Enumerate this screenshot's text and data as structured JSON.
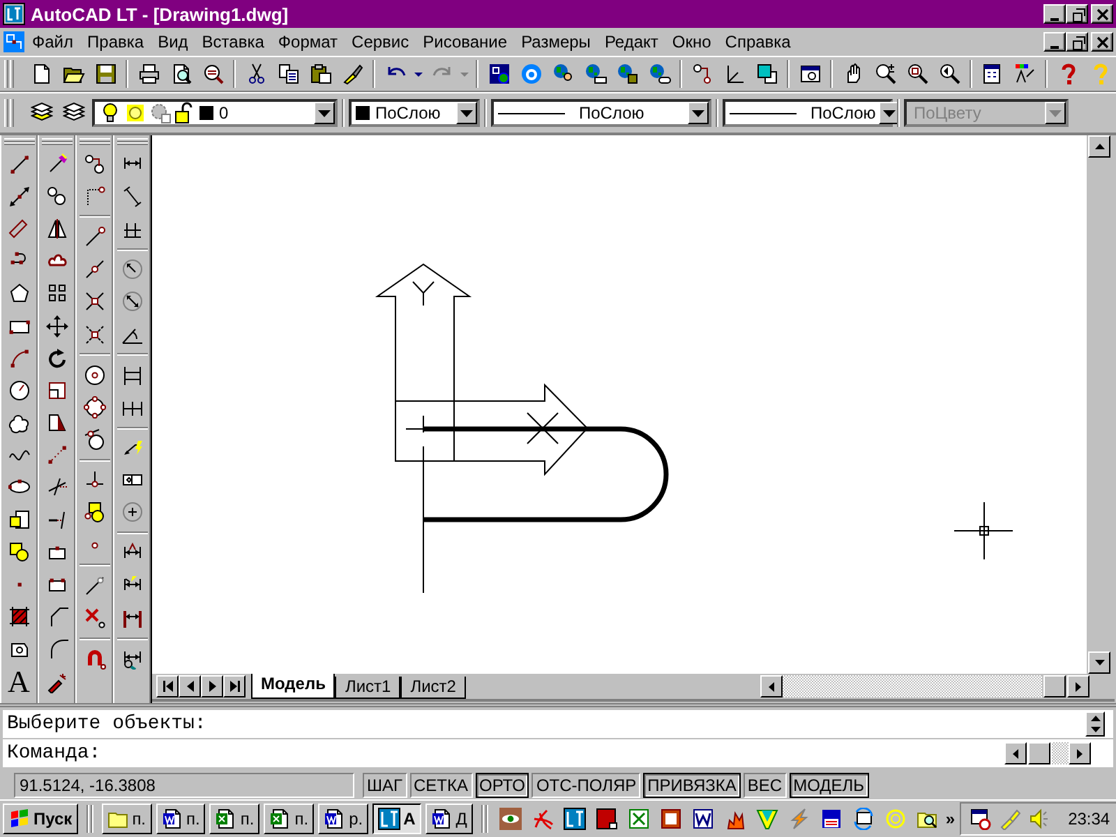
{
  "window": {
    "title": "AutoCAD LT - [Drawing1.dwg]"
  },
  "menu": [
    "Файл",
    "Правка",
    "Вид",
    "Вставка",
    "Формат",
    "Сервис",
    "Рисование",
    "Размеры",
    "Редакт",
    "Окно",
    "Справка"
  ],
  "layer_bar": {
    "layer": "0",
    "color_control": "ПоСлою",
    "linetype": "ПоСлою",
    "lineweight": "ПоСлою",
    "plot_style": {
      "value": "ПоЦвету",
      "disabled": true
    }
  },
  "text_tool": "A",
  "layout_tabs": [
    {
      "label": "Модель",
      "selected": true
    },
    {
      "label": "Лист1",
      "selected": false
    },
    {
      "label": "Лист2",
      "selected": false
    }
  ],
  "command_lines": [
    "Выберите объекты:",
    "Команда:"
  ],
  "status_bar": {
    "coordinates": "91.5124, -16.3808",
    "toggles": [
      {
        "label": "ШАГ",
        "on": false
      },
      {
        "label": "СЕТКА",
        "on": false
      },
      {
        "label": "ОРТО",
        "on": true
      },
      {
        "label": "ОТС-ПОЛЯР",
        "on": false
      },
      {
        "label": "ПРИВЯЗКА",
        "on": true
      },
      {
        "label": "ВЕС",
        "on": false
      },
      {
        "label": "МОДЕЛЬ",
        "on": true
      }
    ]
  },
  "taskbar": {
    "start": "Пуск",
    "buttons": [
      {
        "kind": "folder",
        "label": "п.",
        "selected": false
      },
      {
        "kind": "word",
        "label": "п.",
        "selected": false
      },
      {
        "kind": "excel",
        "label": "п.",
        "selected": false
      },
      {
        "kind": "excel",
        "label": "п.",
        "selected": false
      },
      {
        "kind": "word",
        "label": "р.",
        "selected": false
      },
      {
        "kind": "autocad",
        "label": "A",
        "selected": true
      },
      {
        "kind": "word",
        "label": "Д",
        "selected": false
      }
    ],
    "overflow": "»",
    "clock": "23:34"
  }
}
